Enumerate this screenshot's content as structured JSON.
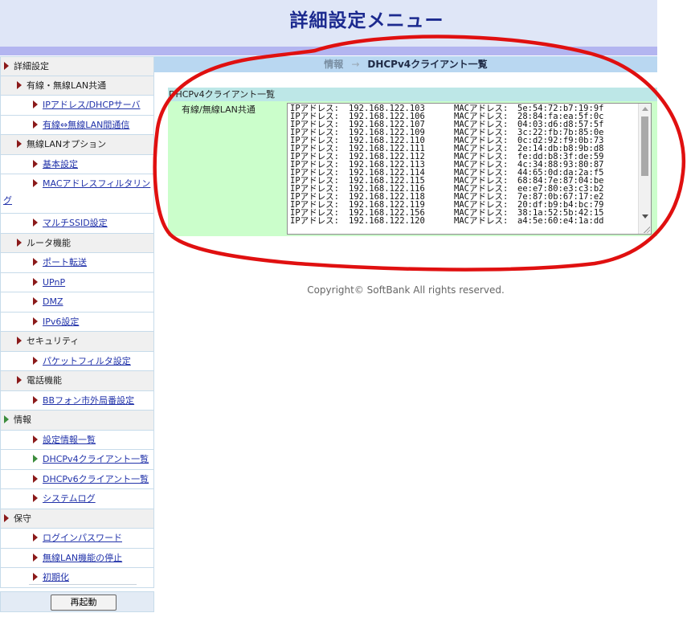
{
  "header": {
    "title": "詳細設定メニュー"
  },
  "sidebar": {
    "items": [
      {
        "label": "詳細設定",
        "level": 0,
        "type": "group"
      },
      {
        "label": "有線・無線LAN共通",
        "level": 1,
        "type": "group"
      },
      {
        "label": "IPアドレス/DHCPサーバ",
        "level": 2,
        "type": "link"
      },
      {
        "label": "有線⇔無線LAN間通信",
        "level": 2,
        "type": "link"
      },
      {
        "label": "無線LANオプション",
        "level": 1,
        "type": "group"
      },
      {
        "label": "基本設定",
        "level": 2,
        "type": "link"
      },
      {
        "label": "MACアドレスフィルタリン",
        "label_wrap": "グ",
        "level": 2,
        "type": "link"
      },
      {
        "label": "マルチSSID設定",
        "level": 2,
        "type": "link"
      },
      {
        "label": "ルータ機能",
        "level": 1,
        "type": "group"
      },
      {
        "label": "ポート転送",
        "level": 2,
        "type": "link"
      },
      {
        "label": "UPnP",
        "level": 2,
        "type": "link"
      },
      {
        "label": "DMZ",
        "level": 2,
        "type": "link"
      },
      {
        "label": "IPv6設定",
        "level": 2,
        "type": "link"
      },
      {
        "label": "セキュリティ",
        "level": 1,
        "type": "group"
      },
      {
        "label": "パケットフィルタ設定",
        "level": 2,
        "type": "link"
      },
      {
        "label": "電話機能",
        "level": 1,
        "type": "group"
      },
      {
        "label": "BBフォン市外局番設定",
        "level": 2,
        "type": "link"
      },
      {
        "label": "情報",
        "level": 0,
        "type": "group",
        "marker": "green"
      },
      {
        "label": "設定情報一覧",
        "level": 2,
        "type": "link"
      },
      {
        "label": "DHCPv4クライアント一覧",
        "level": 2,
        "type": "link",
        "marker": "green"
      },
      {
        "label": "DHCPv6クライアント一覧",
        "level": 2,
        "type": "link"
      },
      {
        "label": "システムログ",
        "level": 2,
        "type": "link"
      },
      {
        "label": "保守",
        "level": 0,
        "type": "group"
      },
      {
        "label": "ログインパスワード",
        "level": 2,
        "type": "link"
      },
      {
        "label": "無線LAN機能の停止",
        "level": 2,
        "type": "link"
      },
      {
        "label": "初期化",
        "level": 2,
        "type": "link"
      }
    ],
    "reboot_button": "再起動"
  },
  "main": {
    "breadcrumb": {
      "section": "情報",
      "arrow": "→",
      "page": "DHCPv4クライアント一覧"
    },
    "section_title": "DHCPv4クライアント一覧",
    "row_label": "有線/無線LAN共通",
    "ip_label": "IPアドレス:",
    "mac_label": "MACアドレス:",
    "clients": [
      {
        "ip": "192.168.122.103",
        "mac": "5e:54:72:b7:19:9f"
      },
      {
        "ip": "192.168.122.106",
        "mac": "28:84:fa:ea:5f:0c"
      },
      {
        "ip": "192.168.122.107",
        "mac": "04:03:d6:d8:57:5f"
      },
      {
        "ip": "192.168.122.109",
        "mac": "3c:22:fb:7b:85:0e"
      },
      {
        "ip": "192.168.122.110",
        "mac": "0c:d2:92:f9:0b:73"
      },
      {
        "ip": "192.168.122.111",
        "mac": "2e:14:db:b8:9b:d8"
      },
      {
        "ip": "192.168.122.112",
        "mac": "fe:dd:b8:3f:de:59"
      },
      {
        "ip": "192.168.122.113",
        "mac": "4c:34:88:93:80:87"
      },
      {
        "ip": "192.168.122.114",
        "mac": "44:65:0d:da:2a:f5"
      },
      {
        "ip": "192.168.122.115",
        "mac": "68:84:7e:87:04:be"
      },
      {
        "ip": "192.168.122.116",
        "mac": "ee:e7:80:e3:c3:b2"
      },
      {
        "ip": "192.168.122.118",
        "mac": "7e:87:0b:67:17:e2"
      },
      {
        "ip": "192.168.122.119",
        "mac": "20:df:b9:b4:bc:79"
      },
      {
        "ip": "192.168.122.156",
        "mac": "38:1a:52:5b:42:15"
      },
      {
        "ip": "192.168.122.120",
        "mac": "a4:5e:60:e4:1a:dd"
      }
    ],
    "copyright": "Copyright© SoftBank All rights reserved."
  },
  "colors": {
    "header_bg": "#dfe6f7",
    "header_title": "#1c2a8f",
    "breadcrumb_bg": "#b9d7f1",
    "section_bg": "#bde7e7",
    "row_bg": "#cbfecb",
    "annotation": "#e01010"
  }
}
